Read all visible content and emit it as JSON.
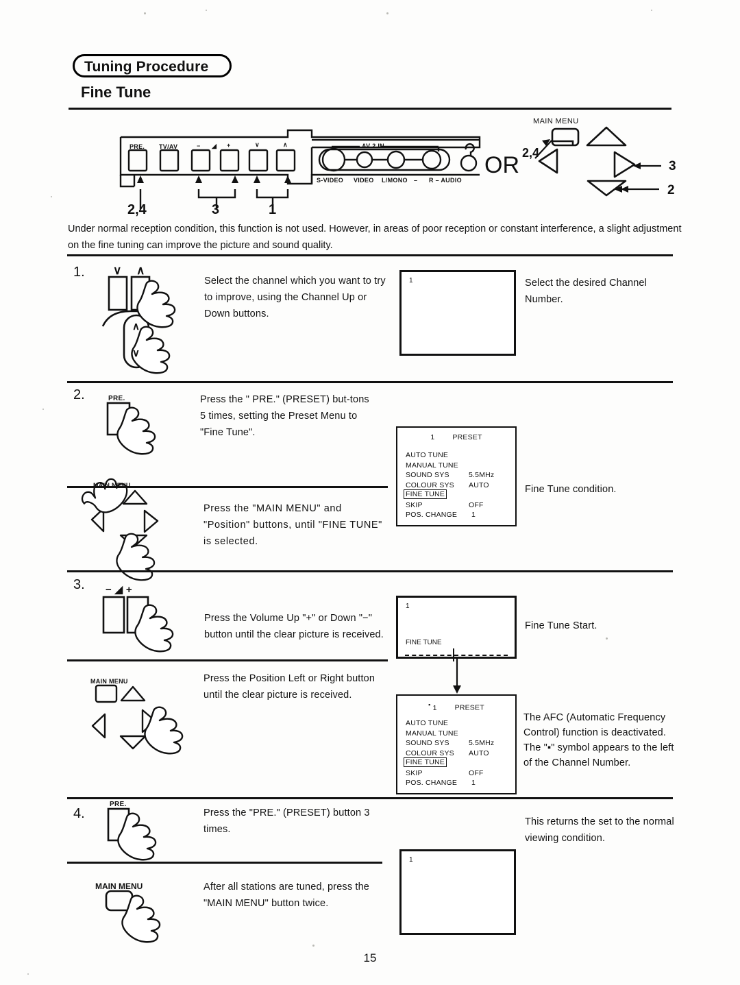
{
  "document": {
    "section_title": "Tuning Procedure",
    "page_title": "Fine Tune",
    "page_number": "15"
  },
  "intro": {
    "paragraph": "Under normal reception condition, this function is not used. However, in areas of poor reception or constant interference, a slight adjustment on the fine tuning can improve the picture and sound quality."
  },
  "remote_diagram": {
    "panel_buttons": [
      "PRE.",
      "TV/AV",
      "−",
      "◢",
      "+",
      "∨",
      "∧"
    ],
    "button_labels": {
      "pre": "PRE.",
      "tvav": "TV/AV",
      "vol_down": "−",
      "vol_icon": "◢",
      "vol_up": "+",
      "ch_down": "∨",
      "ch_up": "∧"
    },
    "callouts": {
      "pre": "2,4",
      "volume": "3",
      "channel": "1"
    },
    "av_panel": {
      "title": "AV 2 IN",
      "jacks": [
        "S-VIDEO",
        "VIDEO",
        "L/MONO",
        "–",
        "R – AUDIO"
      ]
    },
    "or_label": "OR",
    "menu_pad": {
      "main_menu_label": "MAIN MENU",
      "main_menu_callout": "2,4",
      "right_callout": "3",
      "down_callout": "2"
    }
  },
  "steps": [
    {
      "number": "1.",
      "remote_caption_up": "∧",
      "remote_caption_down": "∨",
      "instruction": "Select the channel which you want to try to improve, using the Channel Up or Down buttons.",
      "screen": {
        "type": "channel",
        "channel": "1"
      },
      "result": "Select the desired Channel Number."
    },
    {
      "number": "2.",
      "button_label": "PRE.",
      "instruction": "Press the \" PRE.\" (PRESET) but-tons 5 times, setting the Preset Menu to \"Fine Tune\".",
      "sub": {
        "button_label": "MAIN MENU",
        "instruction": "Press the \"MAIN MENU\" and \"Position\" buttons, until \"FINE TUNE\" is selected."
      },
      "screen": {
        "type": "osd",
        "channel": "1",
        "marker": "",
        "heading": "PRESET"
      },
      "result": "Fine Tune condition."
    },
    {
      "number": "3.",
      "button_caption": "− ◢ +",
      "instruction": "Press the Volume Up \"+\" or Down \"−\" button until the clear picture is received.",
      "sub": {
        "button_label": "MAIN MENU",
        "instruction": "Press the Position Left or Right button until the clear picture is received."
      },
      "screen": {
        "type": "finetune",
        "channel": "1",
        "bar_label": "FINE TUNE"
      },
      "result": "Fine Tune Start.",
      "screen2": {
        "type": "osd",
        "channel": "1",
        "marker": "▪",
        "heading": "PRESET"
      },
      "result2": "The AFC (Automatic Frequency Control) function is deactivated. The \"▪\" symbol appears to the left of the Channel Number."
    },
    {
      "number": "4.",
      "button_label": "PRE.",
      "instruction": "Press the \"PRE.\" (PRESET) button 3 times.",
      "sub": {
        "button_label": "MAIN MENU",
        "instruction": "After all stations are tuned, press the \"MAIN MENU\" button twice."
      },
      "result": "This returns the set to the normal viewing condition.",
      "screen": {
        "type": "channel",
        "channel": "1"
      }
    }
  ],
  "osd_menu": {
    "heading": "PRESET",
    "items": [
      {
        "label": "AUTO TUNE",
        "value": ""
      },
      {
        "label": "MANUAL TUNE",
        "value": ""
      },
      {
        "label": "SOUND SYS",
        "value": "5.5MHz"
      },
      {
        "label": "COLOUR SYS",
        "value": "AUTO"
      },
      {
        "label": "FINE TUNE",
        "value": "",
        "selected": true
      },
      {
        "label": "SKIP",
        "value": "OFF"
      },
      {
        "label": "POS. CHANGE",
        "value": "1"
      }
    ]
  },
  "colors": {
    "ink": "#111111",
    "paper": "#fdfdfc"
  }
}
